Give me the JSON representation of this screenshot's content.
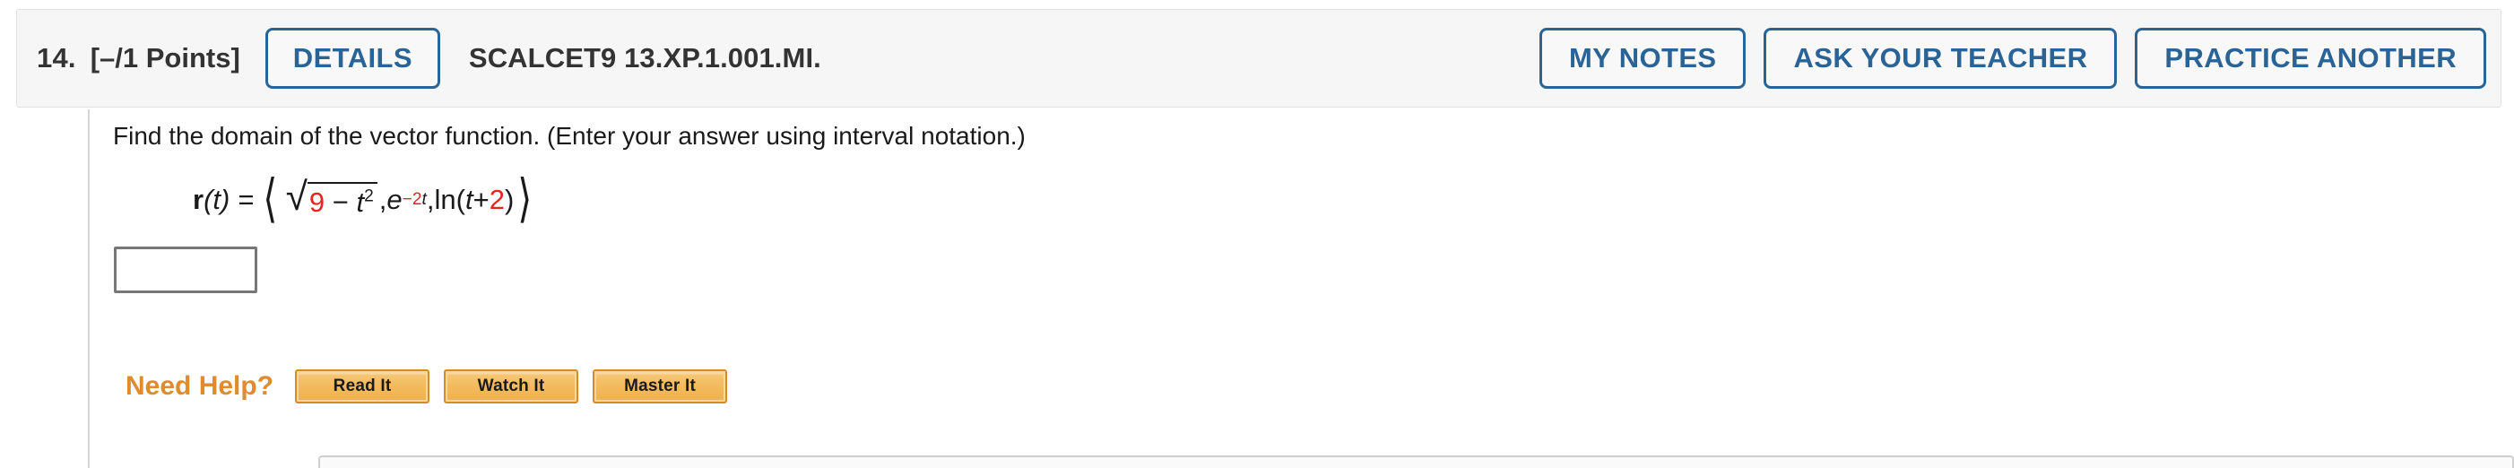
{
  "header": {
    "question_number": "14.",
    "points": "[–/1 Points]",
    "details_label": "DETAILS",
    "problem_id": "SCALCET9 13.XP.1.001.MI.",
    "actions": [
      {
        "label": "MY NOTES",
        "name": "my-notes-button"
      },
      {
        "label": "ASK YOUR TEACHER",
        "name": "ask-your-teacher-button"
      },
      {
        "label": "PRACTICE ANOTHER",
        "name": "practice-another-button"
      }
    ]
  },
  "question": {
    "prompt": "Find the domain of the vector function. (Enter your answer using interval notation.)",
    "formula": {
      "function_name": "r",
      "function_var": "(t) =",
      "open_angle": "⟨",
      "close_angle": "⟩",
      "radical_sign": "√",
      "radicand_const": "9",
      "radicand_minus": " − ",
      "radicand_var": "t",
      "radicand_power": "2",
      "sep1": ", ",
      "exp_base": "e",
      "exp_sign": "−2",
      "exp_var": "t",
      "sep2": ", ",
      "ln_open": "ln(",
      "ln_var": "t",
      "ln_plus": " + ",
      "ln_const": "2",
      "ln_close": ")"
    },
    "answer_value": "",
    "answer_placeholder": ""
  },
  "help": {
    "label": "Need Help?",
    "buttons": [
      {
        "label": "Read It",
        "name": "read-it-button"
      },
      {
        "label": "Watch It",
        "name": "watch-it-button"
      },
      {
        "label": "Master It",
        "name": "master-it-button"
      }
    ]
  },
  "colors": {
    "accent_blue": "#2a6496",
    "help_orange": "#e08b2d",
    "math_red": "#e8251f",
    "header_bg": "#f6f6f6"
  }
}
